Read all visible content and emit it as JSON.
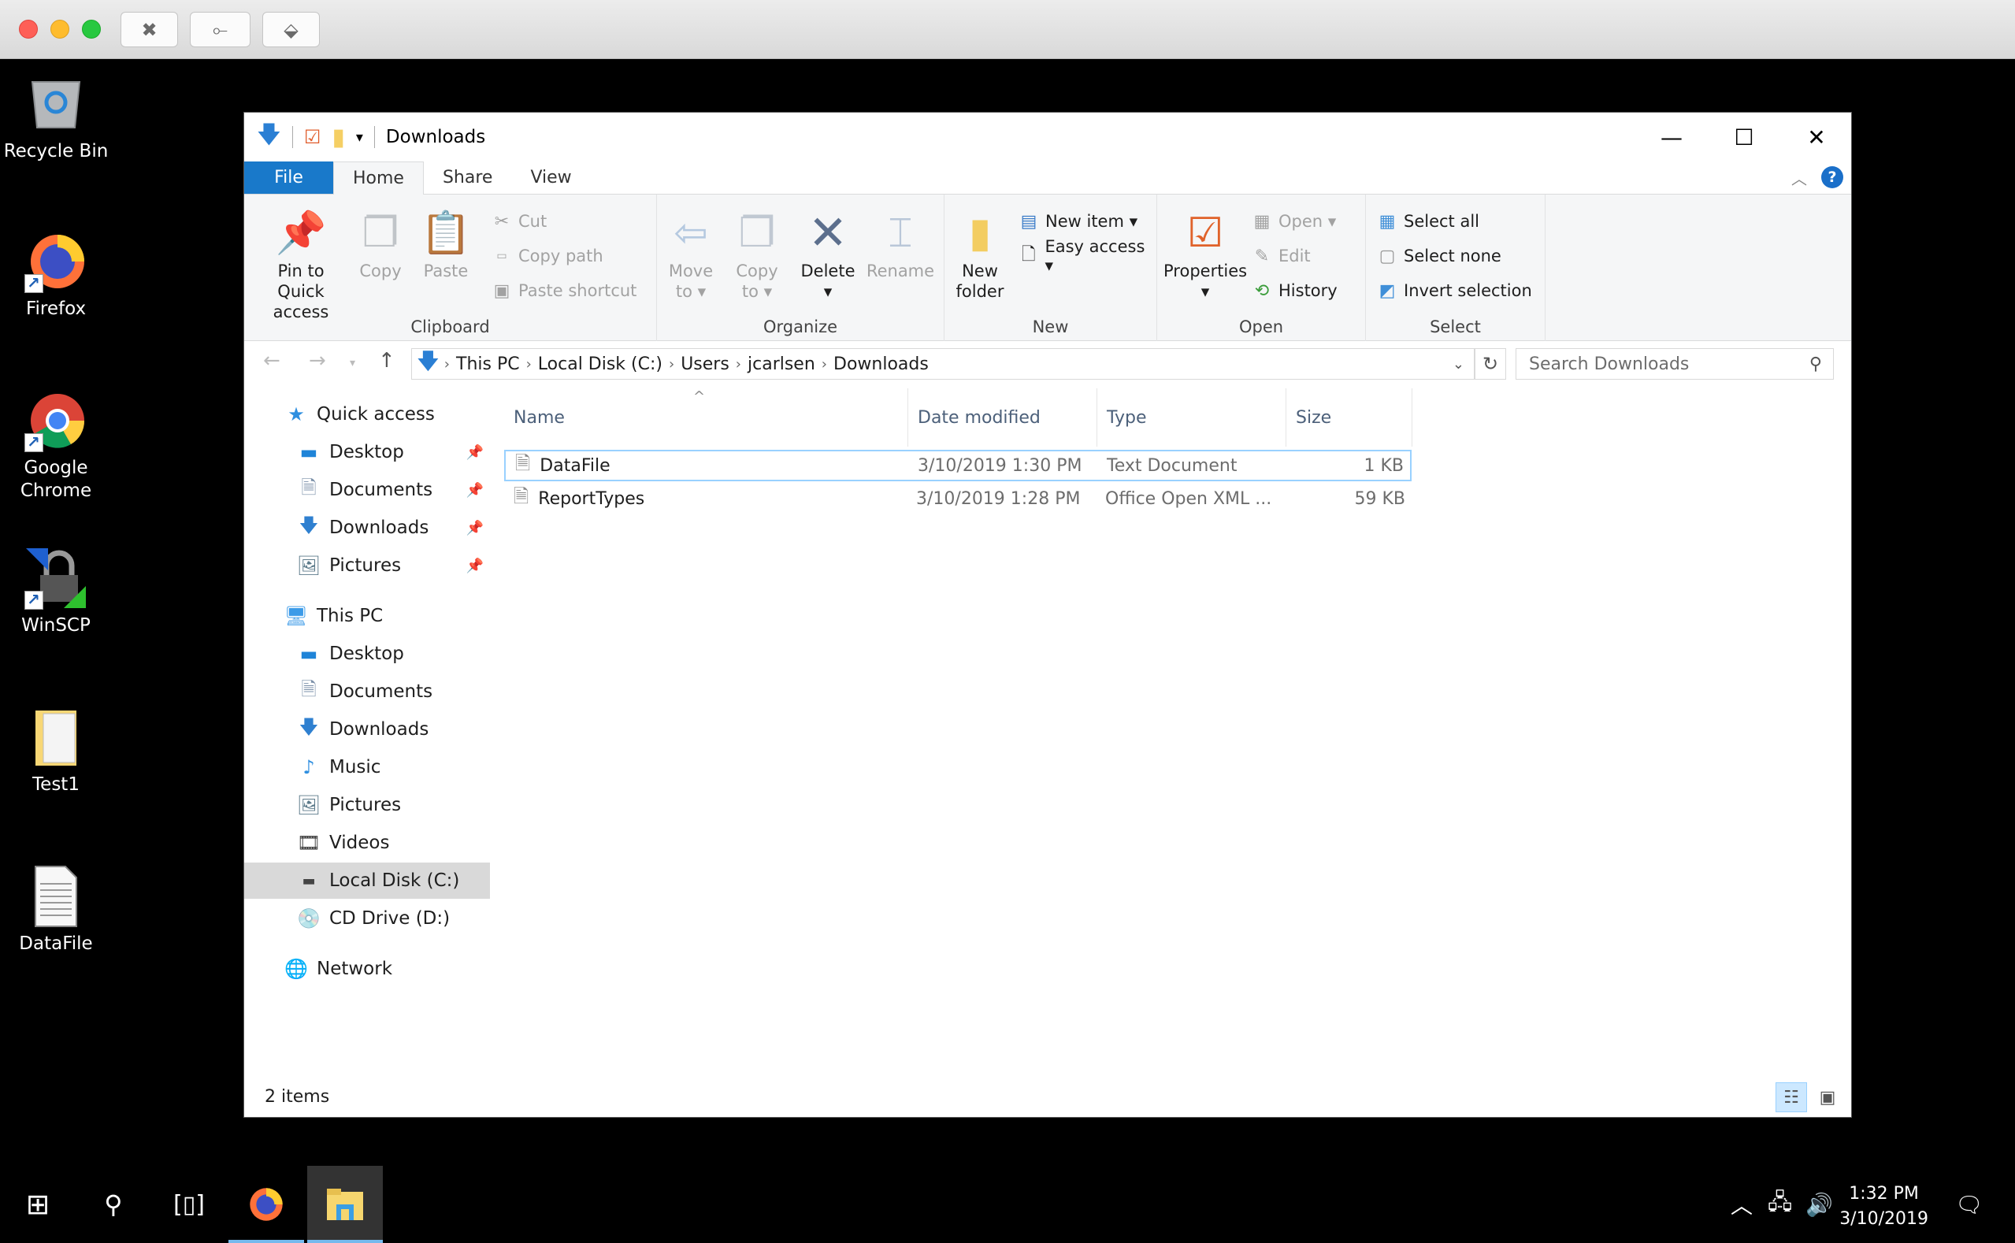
{
  "host": {
    "buttons": [
      {
        "name": "disconnect",
        "glyph": "⊗"
      },
      {
        "name": "usb",
        "glyph": "⭠"
      },
      {
        "name": "network",
        "glyph": "⊞"
      }
    ]
  },
  "desktop": {
    "icons": [
      {
        "label": "Recycle Bin",
        "icon": "recycle-bin-icon"
      },
      {
        "label": "Firefox",
        "icon": "firefox-icon"
      },
      {
        "label": "Google Chrome",
        "icon": "chrome-icon"
      },
      {
        "label": "WinSCP",
        "icon": "winscp-icon"
      },
      {
        "label": "Test1",
        "icon": "folder-icon"
      },
      {
        "label": "DataFile",
        "icon": "text-file-icon"
      }
    ]
  },
  "window": {
    "title": "Downloads",
    "tabs": [
      {
        "label": "File"
      },
      {
        "label": "Home"
      },
      {
        "label": "Share"
      },
      {
        "label": "View"
      }
    ],
    "ribbon": {
      "groups": {
        "clipboard": "Clipboard",
        "organize": "Organize",
        "new": "New",
        "open": "Open",
        "select": "Select"
      },
      "pin_line1": "Pin to Quick",
      "pin_line2": "access",
      "copy": "Copy",
      "paste": "Paste",
      "cut": "Cut",
      "copy_path": "Copy path",
      "paste_shortcut": "Paste shortcut",
      "move_to_line1": "Move",
      "move_to_line2": "to ▾",
      "copy_to_line1": "Copy",
      "copy_to_line2": "to ▾",
      "delete": "Delete",
      "delete_arrow": "▾",
      "rename": "Rename",
      "new_folder_line1": "New",
      "new_folder_line2": "folder",
      "new_item": "New item ▾",
      "easy_access": "Easy access ▾",
      "properties": "Properties",
      "properties_arrow": "▾",
      "open": "Open ▾",
      "edit": "Edit",
      "history": "History",
      "select_all": "Select all",
      "select_none": "Select none",
      "invert_selection": "Invert selection"
    },
    "breadcrumbs": [
      "This PC",
      "Local Disk (C:)",
      "Users",
      "jcarlsen",
      "Downloads"
    ],
    "search_placeholder": "Search Downloads",
    "nav": {
      "quick_access": "Quick access",
      "quick_items": [
        {
          "label": "Desktop",
          "icon": "desktop-icon"
        },
        {
          "label": "Documents",
          "icon": "documents-icon"
        },
        {
          "label": "Downloads",
          "icon": "downloads-icon"
        },
        {
          "label": "Pictures",
          "icon": "pictures-icon"
        }
      ],
      "this_pc": "This PC",
      "pc_items": [
        {
          "label": "Desktop"
        },
        {
          "label": "Documents"
        },
        {
          "label": "Downloads"
        },
        {
          "label": "Music"
        },
        {
          "label": "Pictures"
        },
        {
          "label": "Videos"
        },
        {
          "label": "Local Disk (C:)"
        },
        {
          "label": "CD Drive (D:)"
        }
      ],
      "network": "Network"
    },
    "columns": [
      "Name",
      "Date modified",
      "Type",
      "Size"
    ],
    "files": [
      {
        "name": "DataFile",
        "date": "3/10/2019 1:30 PM",
        "type": "Text Document",
        "size": "1 KB",
        "selected": true
      },
      {
        "name": "ReportTypes",
        "date": "3/10/2019 1:28 PM",
        "type": "Office Open XML ...",
        "size": "59 KB",
        "selected": false
      }
    ],
    "status": "2 items"
  },
  "taskbar": {
    "time": "1:32 PM",
    "date": "3/10/2019"
  }
}
